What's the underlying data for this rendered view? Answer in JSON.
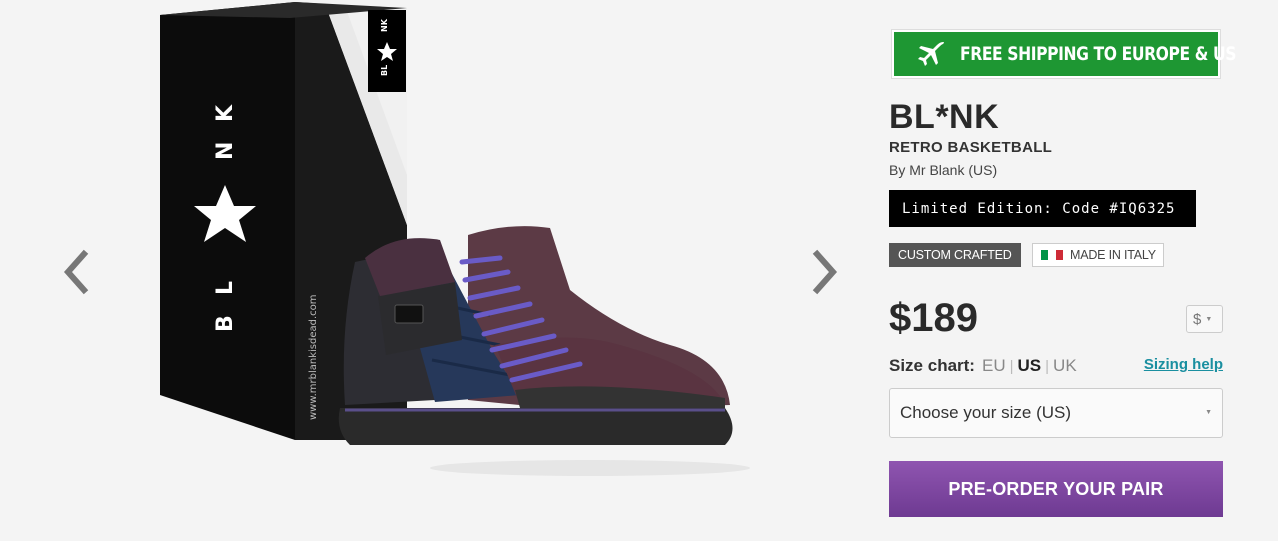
{
  "gallery": {
    "prev_icon": "chevron-left-icon",
    "next_icon": "chevron-right-icon",
    "box_side_url": "www.mrblankisdead.com",
    "logo_letters": [
      "B",
      "L",
      "N",
      "K"
    ]
  },
  "shipping": {
    "icon": "airplane-icon",
    "text": "FREE SHIPPING TO EUROPE & US",
    "color": "#1e9733"
  },
  "product": {
    "brand": "BL*NK",
    "model": "RETRO BASKETBALL",
    "designer": "By Mr Blank (US)",
    "edition": "Limited Edition: Code #IQ6325",
    "badges": {
      "custom": "CUSTOM CRAFTED",
      "origin": "MADE IN ITALY",
      "flag_colors": [
        "#009246",
        "#ffffff",
        "#ce2b37"
      ]
    },
    "price": "$189",
    "currency": "$"
  },
  "size": {
    "label": "Size chart:",
    "options": [
      "EU",
      "US",
      "UK"
    ],
    "selected": "US",
    "help": "Sizing help",
    "select_value": "Choose your size (US)"
  },
  "cta": {
    "label": "PRE-ORDER YOUR PAIR",
    "color": "#7d46a3"
  }
}
